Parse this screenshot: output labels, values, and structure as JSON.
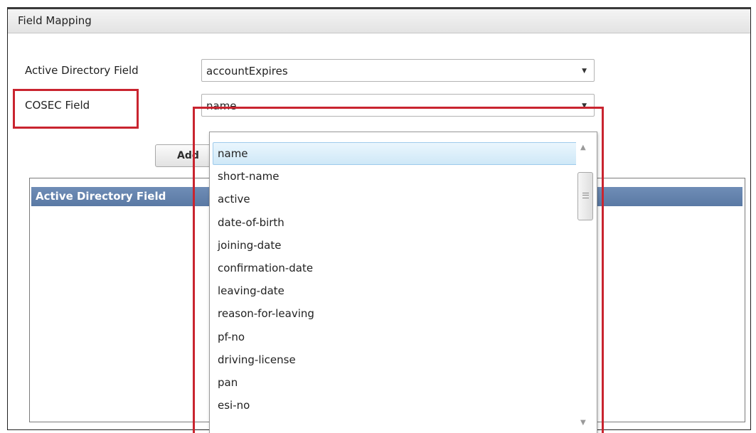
{
  "window": {
    "title": "Field Mapping"
  },
  "form": {
    "ad_field_label": "Active Directory Field",
    "ad_field_value": "accountExpires",
    "cosec_field_label": "COSEC Field",
    "cosec_field_value": "name",
    "add_button_label": "Add",
    "dropdown_arrow": "▼"
  },
  "grid": {
    "column_header": "Active Directory Field"
  },
  "dropdown": {
    "options": [
      "name",
      "short-name",
      "active",
      "date-of-birth",
      "joining-date",
      "confirmation-date",
      "leaving-date",
      "reason-for-leaving",
      "pf-no",
      "driving-license",
      "pan",
      "esi-no"
    ],
    "selected_index": 0,
    "scroll_up_glyph": "▲",
    "scroll_down_glyph": "▼"
  },
  "colors": {
    "highlight_red": "#c9242f",
    "grid_header_blue": "#5f7ea9",
    "selection_blue": "#cfe8f7"
  }
}
